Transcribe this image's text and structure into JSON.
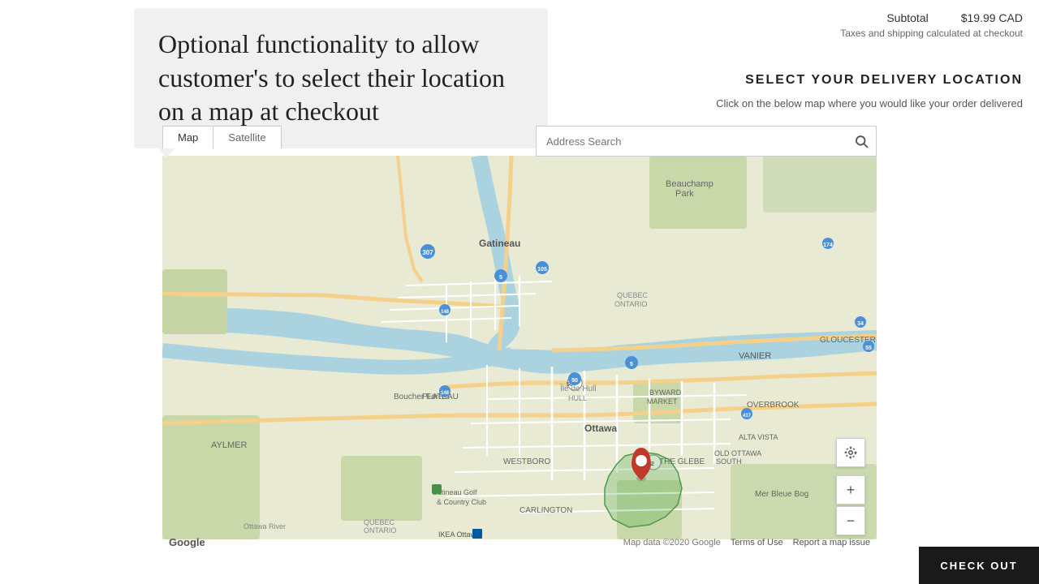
{
  "order": {
    "subtotal_label": "Subtotal",
    "subtotal_value": "$19.99 CAD",
    "tax_note": "Taxes and shipping calculated at checkout"
  },
  "info_box": {
    "text": "Optional functionality to allow customer's to select their location on a map at checkout"
  },
  "delivery": {
    "section_title": "SELECT YOUR DELIVERY LOCATION",
    "section_subtitle": "Click on the below map where you would like your order delivered"
  },
  "map": {
    "tab_map": "Map",
    "tab_satellite": "Satellite",
    "address_placeholder": "Address Search",
    "map_data_credit": "Map data ©2020 Google",
    "terms_link": "Terms of Use",
    "report_link": "Report a map issue"
  },
  "checkout": {
    "label": "CHECK OUT"
  },
  "controls": {
    "zoom_in": "+",
    "zoom_out": "−",
    "location_icon": "⊙"
  }
}
